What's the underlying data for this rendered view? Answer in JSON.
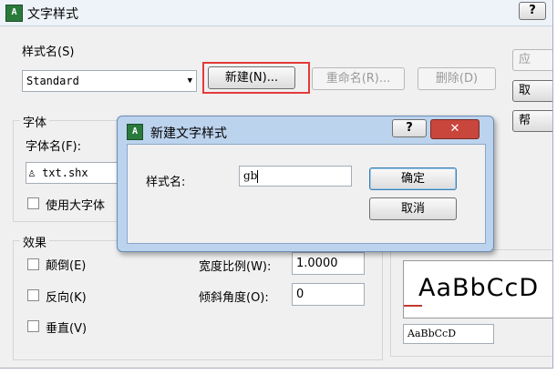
{
  "window": {
    "title": "文字样式",
    "help_button": "?"
  },
  "style_name_group": {
    "label": "样式名(S)",
    "selected": "Standard",
    "new_button": "新建(N)...",
    "rename_button": "重命名(R)...",
    "delete_button": "删除(D)"
  },
  "right_buttons": {
    "apply": "应",
    "close": "取",
    "help": "帮"
  },
  "font_group": {
    "label": "字体",
    "font_name_label": "字体名(F):",
    "font_value": "txt.shx",
    "use_bigfont_label": "使用大字体"
  },
  "effects_group": {
    "label": "效果",
    "upside_down": "颠倒(E)",
    "backwards": "反向(K)",
    "vertical": "垂直(V)",
    "width_factor_label": "宽度比例(W):",
    "width_factor_value": "1.0000",
    "oblique_label": "倾斜角度(O):",
    "oblique_value": "0"
  },
  "preview": {
    "sample_text": "AaBbCcD",
    "input_value": "AaBbCcD"
  },
  "dialog": {
    "title": "新建文字样式",
    "help_button": "?",
    "close_button": "✕",
    "style_name_label": "样式名:",
    "style_name_value": "gb",
    "ok_button": "确定",
    "cancel_button": "取消"
  },
  "colors": {
    "highlight_box": "#e53a3a",
    "dialog_close": "#c9463d",
    "window_icon": "#2a7a3c"
  }
}
